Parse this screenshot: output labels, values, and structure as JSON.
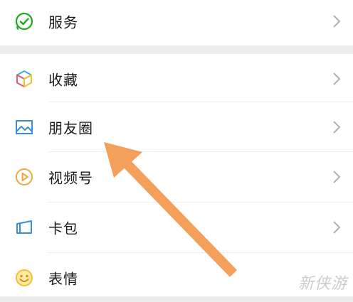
{
  "menu": {
    "services": {
      "label": "服务",
      "icon": "services-icon"
    },
    "favorites": {
      "label": "收藏",
      "icon": "favorites-cube-icon"
    },
    "moments": {
      "label": "朋友圈",
      "icon": "moments-photo-icon"
    },
    "channels": {
      "label": "视频号",
      "icon": "channels-play-icon"
    },
    "cards": {
      "label": "卡包",
      "icon": "card-wallet-icon"
    },
    "stickers": {
      "label": "表情",
      "icon": "sticker-smiley-icon"
    }
  },
  "annotation": {
    "arrow_color": "#f5a05a",
    "points_to": "moments"
  },
  "watermark": {
    "text": "新侠游"
  },
  "colors": {
    "background": "#ffffff",
    "section_gap": "#ededed",
    "divider": "#ececec",
    "services_green": "#1aad19",
    "moments_blue": "#3a8fd4",
    "channels_orange": "#f0a83a",
    "cards_blue": "#3a8fd4",
    "stickers_yellow": "#f2c12e"
  }
}
